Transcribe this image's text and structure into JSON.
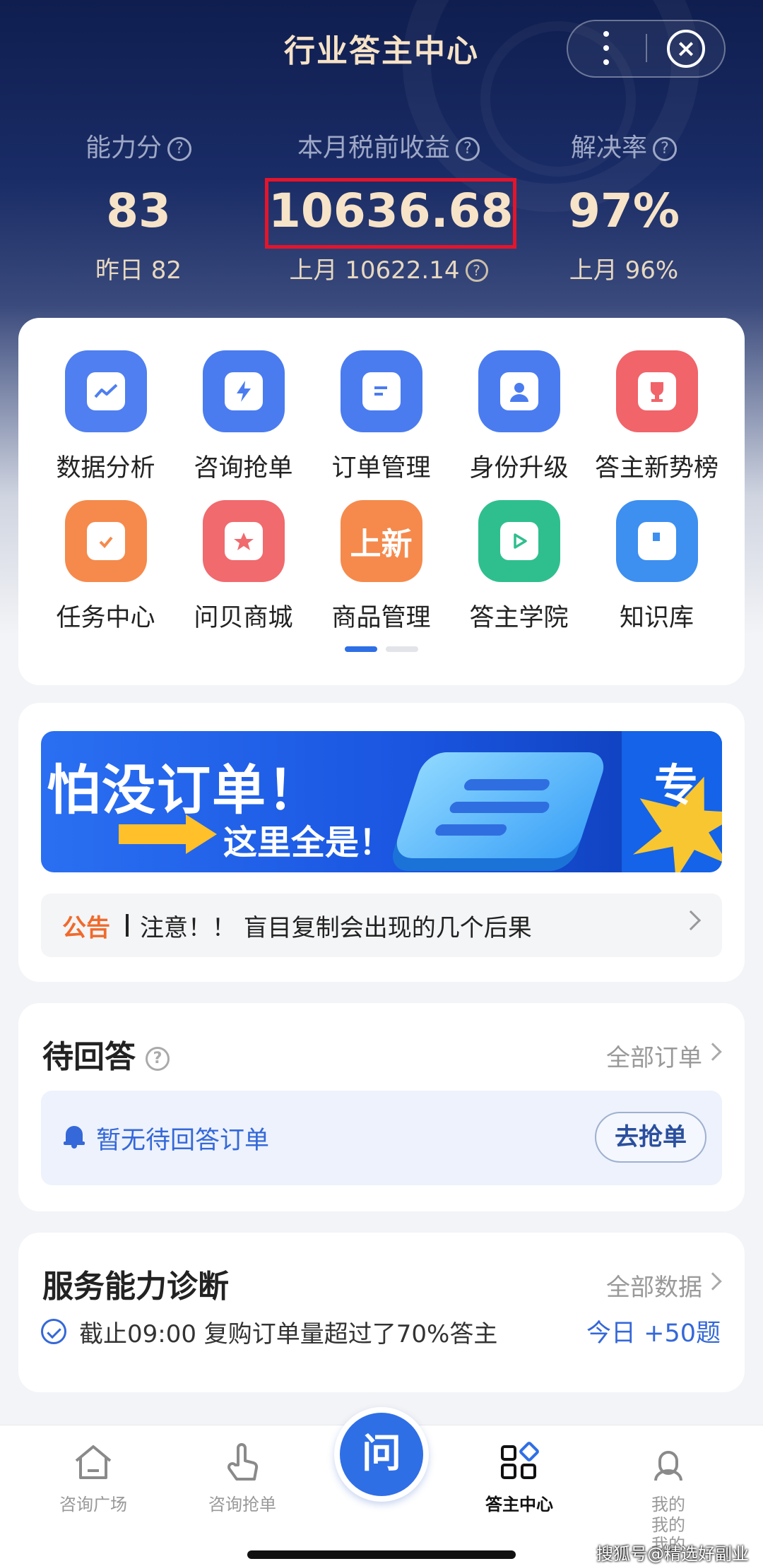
{
  "header": {
    "title": "行业答主中心"
  },
  "stats": [
    {
      "label": "能力分",
      "value": "83",
      "sub": "昨日 82"
    },
    {
      "label": "本月税前收益",
      "value": "10636.68",
      "sub": "上月 10622.14"
    },
    {
      "label": "解决率",
      "value": "97%",
      "sub": "上月 96%"
    }
  ],
  "help_glyph": "?",
  "apps": [
    {
      "label": "数据分析",
      "color": "#4f7ff0",
      "icon": "chart-icon"
    },
    {
      "label": "咨询抢单",
      "color": "#4a7cf0",
      "icon": "lightning-icon"
    },
    {
      "label": "订单管理",
      "color": "#4a7cf0",
      "icon": "document-icon"
    },
    {
      "label": "身份升级",
      "color": "#4a7cf0",
      "icon": "user-icon"
    },
    {
      "label": "答主新势榜",
      "color": "#f0646a",
      "icon": "trophy-icon"
    },
    {
      "label": "任务中心",
      "color": "#f58a4c",
      "icon": "calendar-check-icon"
    },
    {
      "label": "问贝商城",
      "color": "#f06a6e",
      "icon": "shell-icon"
    },
    {
      "label": "商品管理",
      "color": "#f58a4c",
      "icon": "new-tag-icon",
      "glyph_text": "上新"
    },
    {
      "label": "答主学院",
      "color": "#2fbf8f",
      "icon": "play-icon"
    },
    {
      "label": "知识库",
      "color": "#3d8ff0",
      "icon": "book-icon"
    }
  ],
  "banner": {
    "main": "怕没订单！",
    "sub": "这里全是！",
    "right": "专"
  },
  "notice": {
    "tag": "公告",
    "text": "注意！！ 盲目复制会出现的几个后果"
  },
  "pending": {
    "title": "待回答",
    "link": "全部订单",
    "empty_text": "暂无待回答订单",
    "button": "去抢单"
  },
  "diagnosis": {
    "title": "服务能力诊断",
    "link": "全部数据",
    "text": "截止09:00 复购订单量超过了70%答主",
    "today": "今日 +50题"
  },
  "tabs": [
    {
      "label": "咨询广场",
      "icon": "home-icon"
    },
    {
      "label": "咨询抢单",
      "icon": "tap-icon"
    },
    {
      "label": "问",
      "icon": "ask-icon"
    },
    {
      "label": "答主中心",
      "icon": "grid-icon",
      "active": true
    },
    {
      "label": "我的",
      "icon": "profile-icon"
    }
  ],
  "tab_overflow": [
    "我的",
    "我的"
  ],
  "watermark": "搜狐号@精选好副业",
  "colors": {
    "accent": "#2f6fe6",
    "highlight_box": "#e5142b",
    "hero_text": "#f7e3c7"
  }
}
